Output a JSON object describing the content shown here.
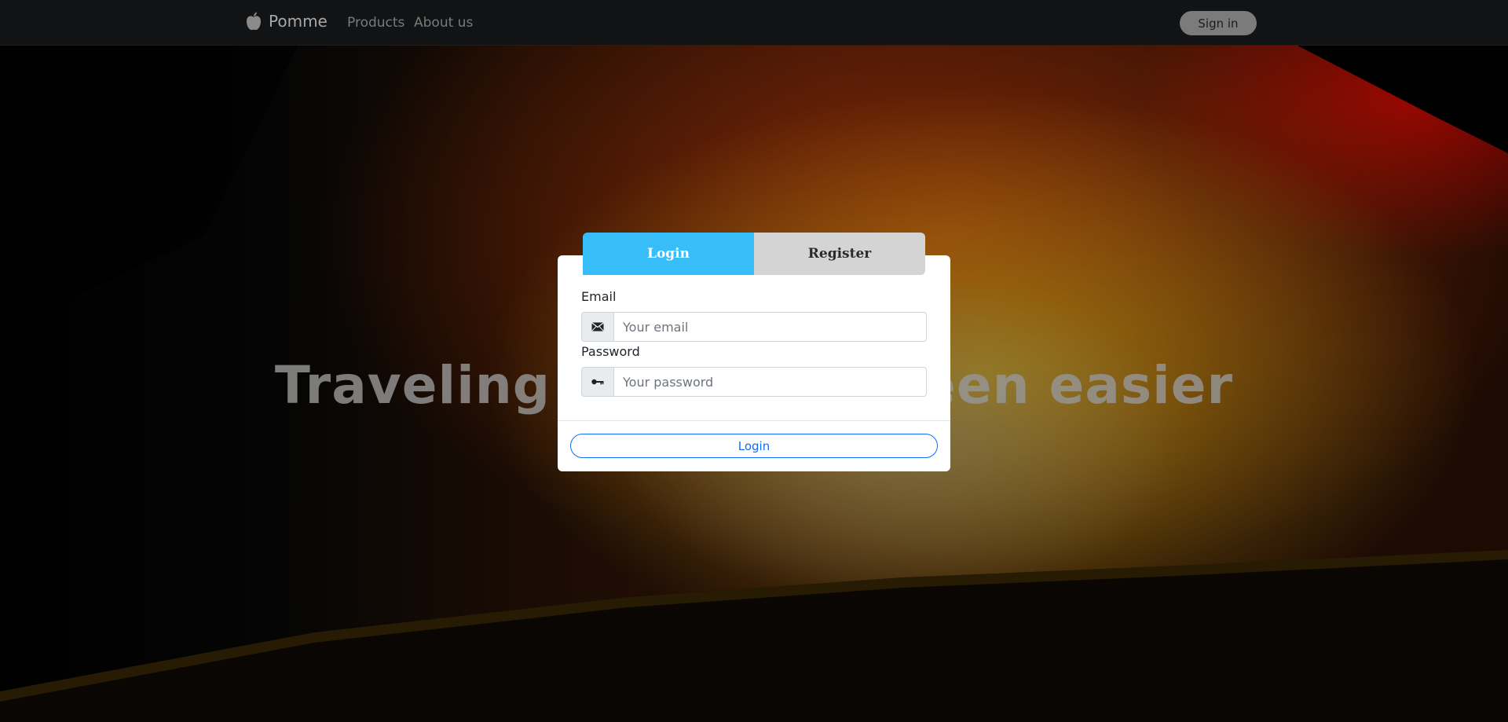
{
  "navbar": {
    "brand": "Pomme",
    "brand_icon": "apple-logo-icon",
    "links": [
      "Products",
      "About us"
    ],
    "signin_label": "Sign in"
  },
  "hero": {
    "headline": "Traveling has never been easier"
  },
  "auth": {
    "tabs": [
      "Login",
      "Register"
    ],
    "active_tab": "Login",
    "email_label": "Email",
    "email_placeholder": "Your email",
    "email_icon": "envelope-icon",
    "password_label": "Password",
    "password_placeholder": "Your password",
    "password_icon": "key-icon",
    "submit_label": "Login"
  },
  "colors": {
    "active_tab": "#37bdf8",
    "inactive_tab": "#d4d4d4",
    "primary": "#0d6efd",
    "navbar": "#111315"
  }
}
